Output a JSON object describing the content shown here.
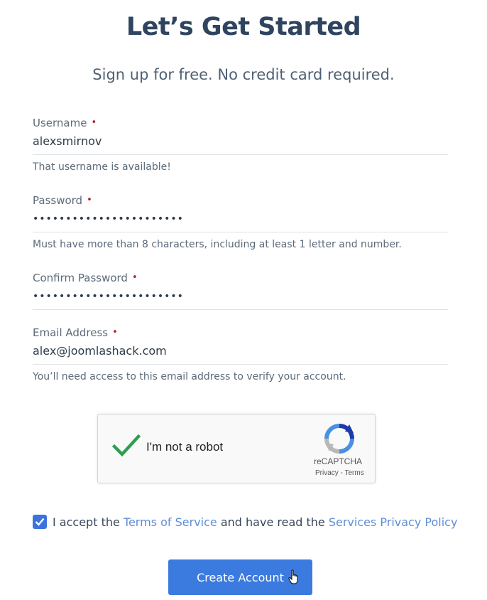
{
  "header": {
    "title": "Let’s Get Started",
    "subtitle": "Sign up for free. No credit card required."
  },
  "form": {
    "username": {
      "label": "Username",
      "required_mark": "•",
      "value": "alexsmirnov",
      "help": "That username is available!"
    },
    "password": {
      "label": "Password",
      "required_mark": "•",
      "value": "•••••••••••••••••••••••",
      "help": "Must have more than 8 characters, including at least 1 letter and number."
    },
    "confirm_password": {
      "label": "Confirm Password",
      "required_mark": "•",
      "value": "•••••••••••••••••••••••"
    },
    "email": {
      "label": "Email Address",
      "required_mark": "•",
      "value": "alex@joomlashack.com",
      "help": "You’ll need access to this email address to verify your account."
    }
  },
  "captcha": {
    "label": "I'm not a robot",
    "brand": "reCAPTCHA",
    "links": "Privacy - Terms",
    "checked": true,
    "icon": "recaptcha-logo-icon"
  },
  "terms": {
    "checked": true,
    "prefix": "I accept the ",
    "tos_link": "Terms of Service",
    "middle": " and have read the ",
    "privacy_link": "Services Privacy Policy"
  },
  "submit": {
    "label": "Create Account"
  },
  "colors": {
    "title": "#2f4460",
    "required": "#b3202a",
    "link": "#5e8ed6",
    "button": "#3b7be0",
    "checkbox": "#3b73db",
    "captcha_check": "#2e9e4f"
  }
}
